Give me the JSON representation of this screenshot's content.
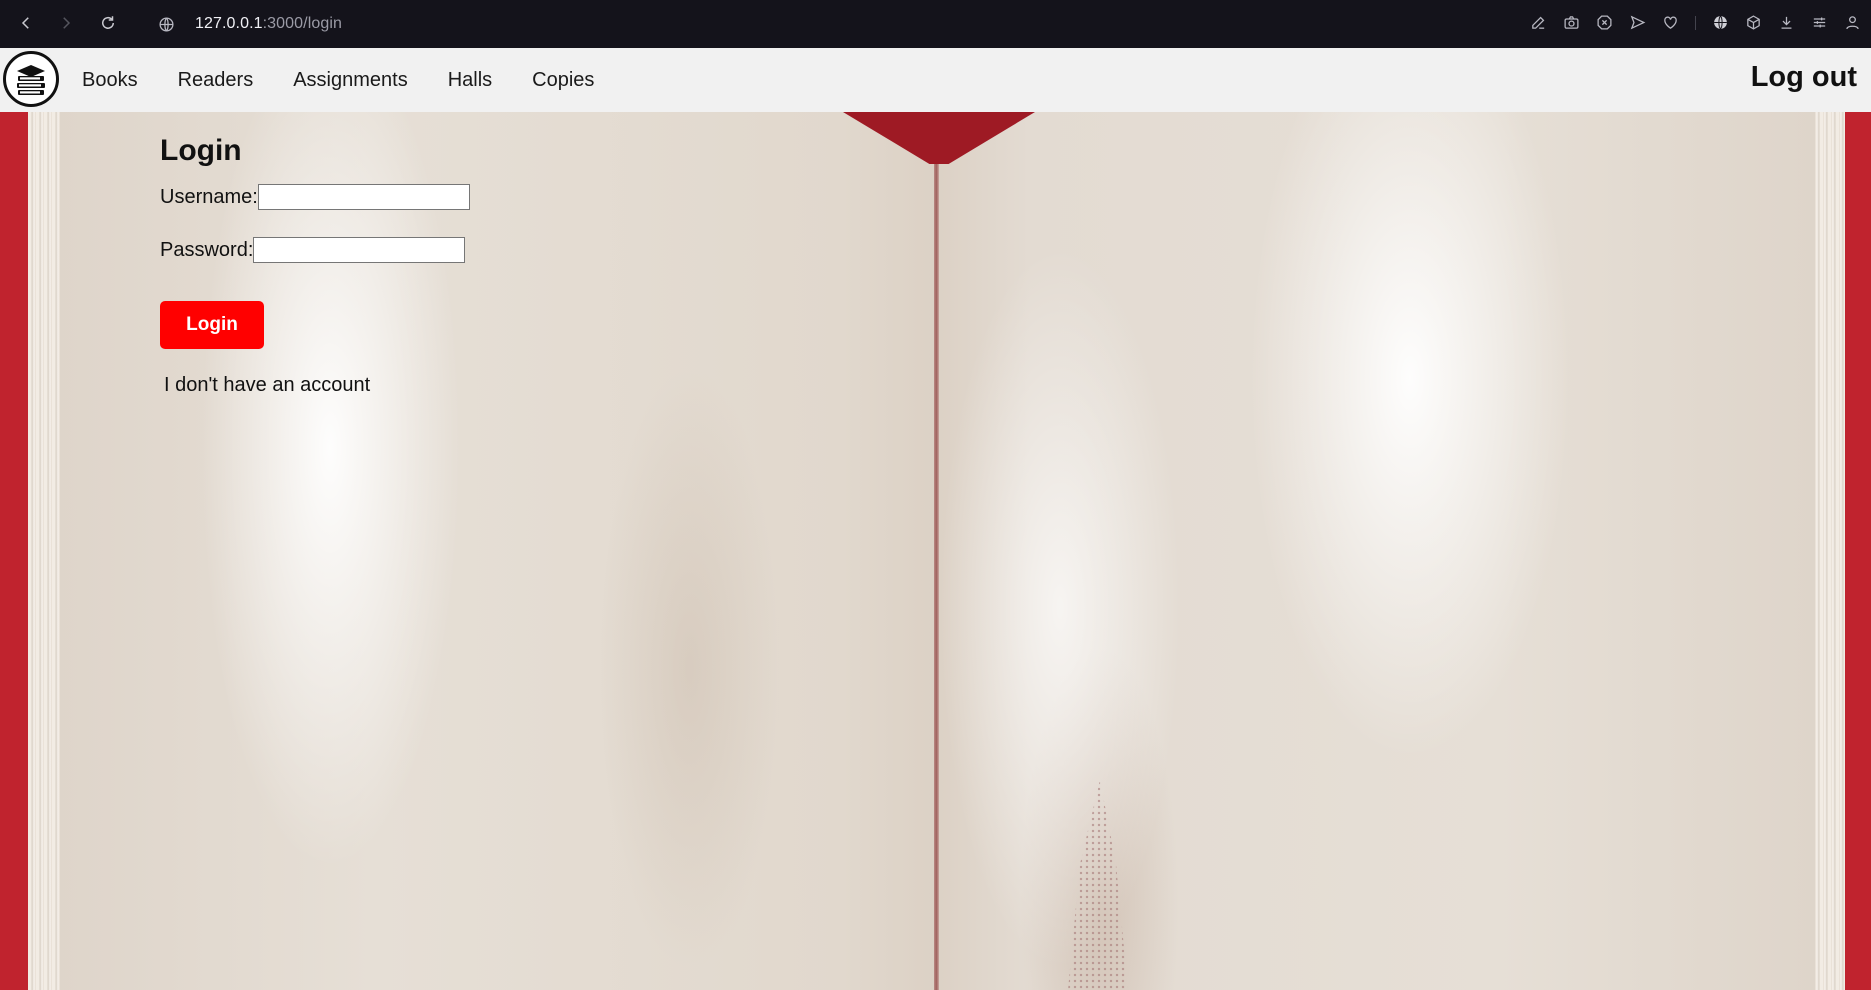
{
  "browser": {
    "url_host": "127.0.0.1",
    "url_path": ":3000/login",
    "icons": [
      "back-icon",
      "forward-icon",
      "reload-icon",
      "site-info-icon",
      "edit-icon",
      "camera-icon",
      "adblock-icon",
      "send-icon",
      "heart-icon",
      "globe-icon",
      "cube-icon",
      "download-icon",
      "settings-sliders-icon",
      "profile-icon"
    ]
  },
  "navbar": {
    "links": [
      "Books",
      "Readers",
      "Assignments",
      "Halls",
      "Copies"
    ],
    "logout_label": "Log out",
    "logo_icon": "books-stack-icon"
  },
  "login": {
    "title": "Login",
    "username_label": "Username:",
    "password_label": "Password:",
    "username_value": "",
    "password_value": "",
    "submit_label": "Login",
    "no_account_label": "I don't have an account"
  },
  "colors": {
    "accent": "#ff0000",
    "book_red": "#c0232e",
    "navbar_bg": "#f1f1f1",
    "browser_bg": "#14131b"
  }
}
